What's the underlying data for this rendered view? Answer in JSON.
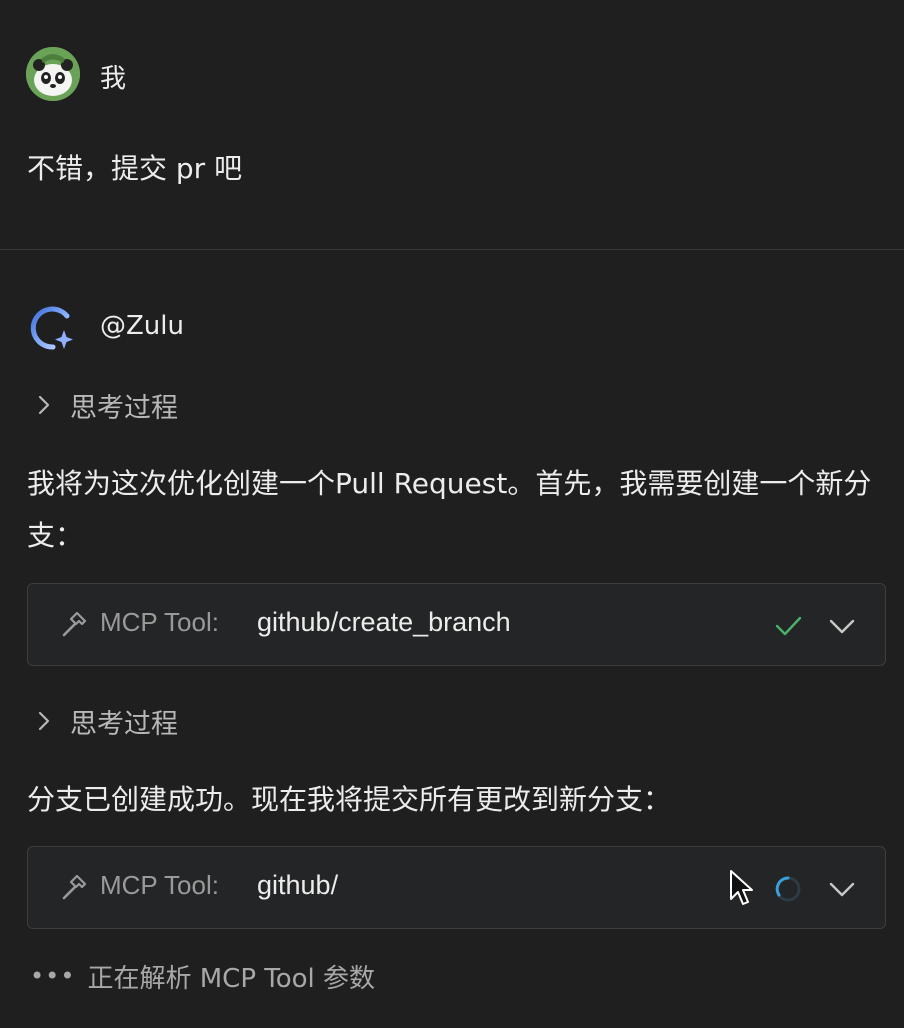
{
  "user": {
    "name": "我",
    "message": "不错，提交 pr 吧"
  },
  "assistant": {
    "name": "@Zulu",
    "thinking_label_1": "思考过程",
    "paragraph_1": "我将为这次优化创建一个Pull Request。首先，我需要创建一个新分支：",
    "tool_1": {
      "prefix": "MCP Tool:",
      "name": "github/create_branch",
      "status": "success"
    },
    "thinking_label_2": "思考过程",
    "paragraph_2": "分支已创建成功。现在我将提交所有更改到新分支：",
    "tool_2": {
      "prefix": "MCP Tool:",
      "name": "github/",
      "status": "loading"
    },
    "pending": {
      "dots": "•••",
      "text": "正在解析 MCP Tool 参数"
    }
  },
  "colors": {
    "background": "#1f1f20",
    "card": "#242526",
    "success": "#4caf6a",
    "spinner": "#3aa0d8"
  },
  "icons": {
    "user_avatar": "panda-avatar-icon",
    "bot_avatar": "zulu-logo-icon",
    "thinking": "chevron-right-icon",
    "tool": "hammer-icon",
    "status_done": "check-icon",
    "status_loading": "spinner-icon",
    "expand": "chevron-down-icon"
  }
}
